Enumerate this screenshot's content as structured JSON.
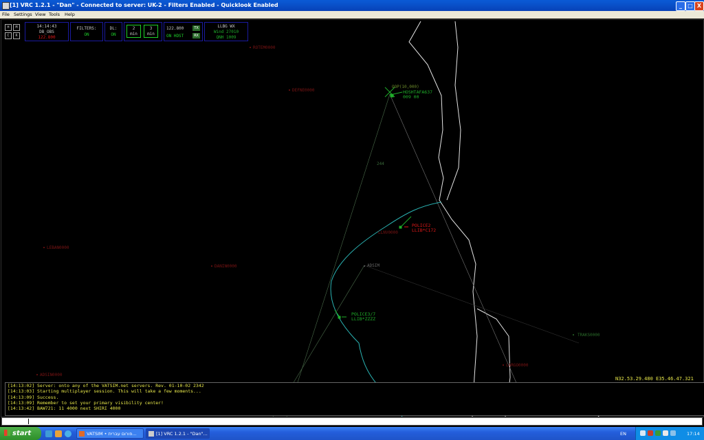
{
  "window": {
    "title": "[1] VRC 1.2.1 - \"Dan\" - Connected to server: UK-2 - Filters Enabled - Quicklook Enabled",
    "minimize": "_",
    "maximize": "□",
    "close": "X"
  },
  "menu": [
    "File",
    "Settings",
    "View",
    "Tools",
    "Help"
  ],
  "panels": {
    "buttons": [
      "H",
      "M",
      "C",
      "R"
    ],
    "clock": {
      "time": "14:14:43",
      "callsign": "DB_OBS",
      "freq": "122.800"
    },
    "filters": {
      "label": "FILTERS:",
      "value": "ON"
    },
    "dl": {
      "label": "DL:",
      "value": "ON"
    },
    "timers": [
      {
        "value": "2",
        "unit": "min"
      },
      {
        "value": "3",
        "unit": "min"
      }
    ],
    "comms": {
      "freq": "122.800",
      "tx": "TX",
      "status": "ON HDST",
      "rx": "RX"
    },
    "wx": {
      "station": "LLBG WX",
      "wind": "Wind 27010",
      "qnh": "QNH 1009"
    }
  },
  "fixes": [
    {
      "label": "ROTEM0000"
    },
    {
      "label": "DEFNE0000"
    },
    {
      "label": "LEBAN0000"
    },
    {
      "label": "DANIN0000"
    },
    {
      "label": "ADSIN0000"
    },
    {
      "label": "LARGO0000"
    },
    {
      "label": "TRAKS0000"
    },
    {
      "label": "ADSIM"
    },
    {
      "label": "LLNV0000"
    },
    {
      "label": "244"
    }
  ],
  "aircraft": [
    {
      "line1": "HOSHTAFA637",
      "line2": "009 00",
      "above": "OOP(10,000)",
      "color": "#1fae2a"
    },
    {
      "line1": "POLICE2",
      "line2": "LLIB*C172",
      "side": "0040000",
      "color": "#e01818"
    },
    {
      "line1": "POLICE3/7",
      "line2": "LLIB*ZZZZ",
      "color": "#1fae2a"
    }
  ],
  "coordinates": "N32.53.29.480 E35.46.47.321",
  "messages": [
    "[14:13:02] Server: onto any of the VATSIM.net servers. Rev. 01-10-02 2342",
    "[14:13:03] Starting multiplayer session. This will take a few moments...",
    "[14:13:09] Success.",
    "[14:13:09] Remember to set your primary visibility center!",
    "[14:13:42] BAW721: 11 4000 next SHIRI 4000"
  ],
  "taskbar": {
    "start": "start",
    "tasks": [
      {
        "label": "VATSIM • פורום עברית..."
      },
      {
        "label": "[1] VRC 1.2.1 - \"Dan\"..."
      }
    ],
    "lang": "EN",
    "clock": "17:14"
  },
  "colors": {
    "radar_bg": "#000000",
    "coast": "#2ab3b3",
    "border": "#e6e6e6",
    "fix": "#7a1414",
    "message_text": "#e8e84a",
    "titlebar": "#0a5bd6"
  }
}
